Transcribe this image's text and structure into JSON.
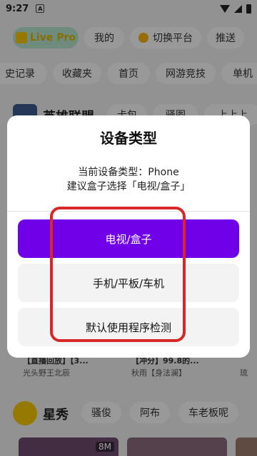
{
  "status_bar": {
    "time": "9:27",
    "notif_letter": "A"
  },
  "top_chips": {
    "live_pro": "Live Pro",
    "mine": "我的",
    "switch_platform": "切换平台",
    "push": "推送"
  },
  "nav_chips": [
    "史记录",
    "收藏夹",
    "首页",
    "网游竞技",
    "单机"
  ],
  "hero_section": {
    "title": "英雄联盟",
    "chips": [
      "卡包",
      "骚图",
      "上上上"
    ]
  },
  "streamer_names": [
    "光头野王北辰",
    "秋雨【身法澜】",
    "琉"
  ],
  "stream_titles": [
    "【直播回放】【3...",
    "【冲分】99.8的...",
    ""
  ],
  "star_section": {
    "title": "星秀",
    "chips": [
      "骚俊",
      "阿布",
      "车老板呢"
    ]
  },
  "thumb_badge": "8M",
  "dialog": {
    "title": "设备类型",
    "current_line": "当前设备类型：Phone",
    "suggest_line": "建议盒子选择「电视/盒子」",
    "options": [
      "电视/盒子",
      "手机/平板/车机",
      "默认使用程序检测"
    ],
    "selected_index": 0
  },
  "colors": {
    "accent": "#7000e8",
    "highlight": "#d62828"
  }
}
